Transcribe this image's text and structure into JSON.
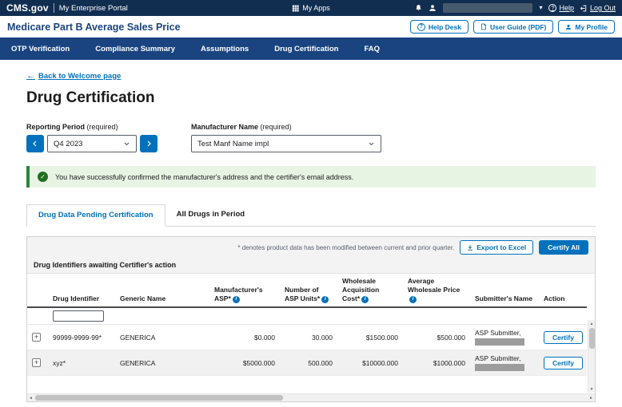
{
  "topbar": {
    "logo": "CMS.gov",
    "portal_name": "My Enterprise Portal",
    "my_apps": "My Apps",
    "help": "Help",
    "logout": "Log Out"
  },
  "app_header": {
    "title": "Medicare Part B Average Sales Price",
    "help_desk": "Help Desk",
    "user_guide": "User Guide (PDF)",
    "my_profile": "My Profile"
  },
  "nav": {
    "items": [
      {
        "label": "OTP Verification"
      },
      {
        "label": "Compliance Summary"
      },
      {
        "label": "Assumptions"
      },
      {
        "label": "Drug Certification"
      },
      {
        "label": "FAQ"
      }
    ]
  },
  "page": {
    "back_link": "Back to Welcome page",
    "title": "Drug Certification"
  },
  "filters": {
    "reporting_period_label": "Reporting Period",
    "reporting_period_required": "(required)",
    "reporting_period_value": "Q4 2023",
    "manufacturer_label": "Manufacturer Name",
    "manufacturer_required": "(required)",
    "manufacturer_value": "Test Manf Name impl"
  },
  "alert": {
    "message": "You have successfully confirmed the manufacturer's address and the certifier's email address."
  },
  "tabs": {
    "pending": "Drug Data Pending Certification",
    "all_drugs": "All Drugs in Period"
  },
  "grid": {
    "footnote": "* denotes product data has been modified between current and prior quarter.",
    "export_label": "Export to Excel",
    "certify_all_label": "Certify All",
    "caption": "Drug Identifiers awaiting Certifier's action",
    "headers": {
      "drug_identifier": "Drug Identifier",
      "generic_name": "Generic Name",
      "manufacturers_asp": "Manufacturer's ASP*",
      "number_of_asp_units": "Number of ASP Units*",
      "wholesale_acquisition_cost": "Wholesale Acquisition Cost*",
      "average_wholesale_price": "Average Wholesale Price",
      "submitters_name": "Submitter's Name",
      "action": "Action"
    },
    "rows": [
      {
        "drug_identifier": "99999-9999-99*",
        "generic_name": "GENERICA",
        "manufacturers_asp": "$0.000",
        "number_of_asp_units": "30.000",
        "wholesale_acquisition_cost": "$1500.000",
        "average_wholesale_price": "$500.000",
        "submitter": "ASP Submitter,",
        "action_label": "Certify"
      },
      {
        "drug_identifier": "xyz*",
        "generic_name": "GENERICA",
        "manufacturers_asp": "$5000.000",
        "number_of_asp_units": "500.000",
        "wholesale_acquisition_cost": "$10000.000",
        "average_wholesale_price": "$1000.000",
        "submitter": "ASP Submitter,",
        "action_label": "Certify"
      }
    ]
  },
  "icons": {
    "question_mark": "?",
    "caret_down": "▾",
    "check_mark": "✓",
    "back_arrow": "←",
    "plus": "+",
    "info": "i",
    "scroll_up": "▲",
    "scroll_down": "▼",
    "scroll_left": "◄",
    "scroll_right": "►"
  },
  "colors": {
    "topbar_bg": "#112e51",
    "nav_bg": "#1a4480",
    "primary_blue": "#0071bc",
    "success_green": "#216e1f",
    "alert_bg": "#e7f4e4"
  }
}
